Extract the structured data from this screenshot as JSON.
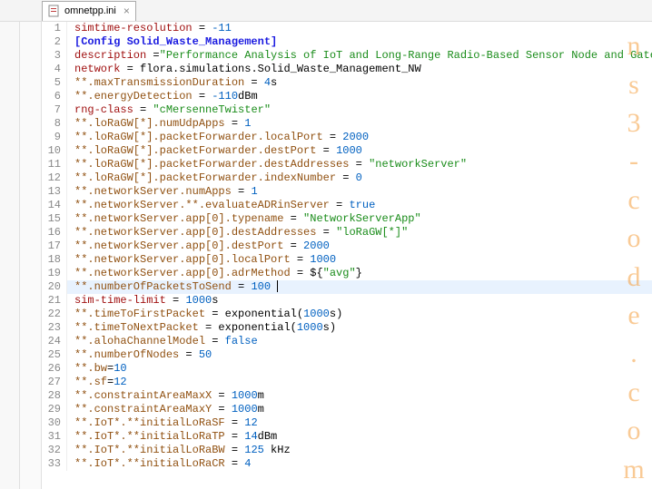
{
  "tab": {
    "title": "omnetpp.ini"
  },
  "watermark": [
    "n",
    "s",
    "3",
    "-",
    "c",
    "o",
    "d",
    "e",
    ".",
    "c",
    "o",
    "m"
  ],
  "lines": [
    {
      "n": 1,
      "ico": "warn",
      "seg": [
        {
          "c": "kw",
          "t": "simtime-resolution"
        },
        {
          "c": "eq",
          "t": " = "
        },
        {
          "c": "num",
          "t": "-11"
        }
      ]
    },
    {
      "n": 2,
      "seg": [
        {
          "c": "sec",
          "t": "[Config Solid_Waste_Management]"
        }
      ]
    },
    {
      "n": 3,
      "seg": [
        {
          "c": "kw",
          "t": "description"
        },
        {
          "c": "eq",
          "t": " ="
        },
        {
          "c": "str",
          "t": "\"Performance Analysis of IoT and Long-Range Radio-Based Sensor Node and Gateway "
        }
      ]
    },
    {
      "n": 4,
      "seg": [
        {
          "c": "kw",
          "t": "network"
        },
        {
          "c": "eq",
          "t": " = flora.simulations.Solid_Waste_Management_NW"
        }
      ]
    },
    {
      "n": 5,
      "seg": [
        {
          "c": "pat",
          "t": "**.maxTransmissionDuration"
        },
        {
          "c": "eq",
          "t": " = "
        },
        {
          "c": "num",
          "t": "4"
        },
        {
          "c": "eq",
          "t": "s"
        }
      ]
    },
    {
      "n": 6,
      "seg": [
        {
          "c": "pat",
          "t": "**.energyDetection"
        },
        {
          "c": "eq",
          "t": " = "
        },
        {
          "c": "num",
          "t": "-110"
        },
        {
          "c": "eq",
          "t": "dBm"
        }
      ]
    },
    {
      "n": 7,
      "seg": [
        {
          "c": "kw",
          "t": "rng-class"
        },
        {
          "c": "eq",
          "t": " = "
        },
        {
          "c": "str",
          "t": "\"cMersenneTwister\""
        }
      ]
    },
    {
      "n": 8,
      "seg": [
        {
          "c": "pat",
          "t": "**.loRaGW[*].numUdpApps"
        },
        {
          "c": "eq",
          "t": " = "
        },
        {
          "c": "num",
          "t": "1"
        }
      ]
    },
    {
      "n": 9,
      "seg": [
        {
          "c": "pat",
          "t": "**.loRaGW[*].packetForwarder.localPort"
        },
        {
          "c": "eq",
          "t": " = "
        },
        {
          "c": "num",
          "t": "2000"
        }
      ]
    },
    {
      "n": 10,
      "seg": [
        {
          "c": "pat",
          "t": "**.loRaGW[*].packetForwarder.destPort"
        },
        {
          "c": "eq",
          "t": " = "
        },
        {
          "c": "num",
          "t": "1000"
        }
      ]
    },
    {
      "n": 11,
      "seg": [
        {
          "c": "pat",
          "t": "**.loRaGW[*].packetForwarder.destAddresses"
        },
        {
          "c": "eq",
          "t": " = "
        },
        {
          "c": "str",
          "t": "\"networkServer\""
        }
      ]
    },
    {
      "n": 12,
      "ico": "info",
      "seg": [
        {
          "c": "pat",
          "t": "**.loRaGW[*].packetForwarder.indexNumber"
        },
        {
          "c": "eq",
          "t": " = "
        },
        {
          "c": "num",
          "t": "0"
        }
      ]
    },
    {
      "n": 13,
      "seg": [
        {
          "c": "pat",
          "t": "**.networkServer.numApps"
        },
        {
          "c": "eq",
          "t": " = "
        },
        {
          "c": "num",
          "t": "1"
        }
      ]
    },
    {
      "n": 14,
      "seg": [
        {
          "c": "pat",
          "t": "**.networkServer.**.evaluateADRinServer"
        },
        {
          "c": "eq",
          "t": " = "
        },
        {
          "c": "num",
          "t": "true"
        }
      ]
    },
    {
      "n": 15,
      "seg": [
        {
          "c": "pat",
          "t": "**.networkServer.app[0].typename"
        },
        {
          "c": "eq",
          "t": " = "
        },
        {
          "c": "str",
          "t": "\"NetworkServerApp\""
        }
      ]
    },
    {
      "n": 16,
      "ico": "info",
      "seg": [
        {
          "c": "pat",
          "t": "**.networkServer.app[0].destAddresses"
        },
        {
          "c": "eq",
          "t": " = "
        },
        {
          "c": "str",
          "t": "\"loRaGW[*]\""
        }
      ]
    },
    {
      "n": 17,
      "seg": [
        {
          "c": "pat",
          "t": "**.networkServer.app[0].destPort"
        },
        {
          "c": "eq",
          "t": " = "
        },
        {
          "c": "num",
          "t": "2000"
        }
      ]
    },
    {
      "n": 18,
      "seg": [
        {
          "c": "pat",
          "t": "**.networkServer.app[0].localPort"
        },
        {
          "c": "eq",
          "t": " = "
        },
        {
          "c": "num",
          "t": "1000"
        }
      ]
    },
    {
      "n": 19,
      "seg": [
        {
          "c": "pat",
          "t": "**.networkServer.app[0].adrMethod"
        },
        {
          "c": "eq",
          "t": " = ${"
        },
        {
          "c": "str",
          "t": "\"avg\""
        },
        {
          "c": "eq",
          "t": "}"
        }
      ]
    },
    {
      "n": 20,
      "hl": true,
      "seg": [
        {
          "c": "pat",
          "t": "**.numberOfPacketsToSend"
        },
        {
          "c": "eq",
          "t": " = "
        },
        {
          "c": "num",
          "t": "100"
        },
        {
          "c": "eq",
          "t": " "
        }
      ],
      "cursor": true
    },
    {
      "n": 21,
      "seg": [
        {
          "c": "kw",
          "t": "sim-time-limit"
        },
        {
          "c": "eq",
          "t": " = "
        },
        {
          "c": "num",
          "t": "1000"
        },
        {
          "c": "eq",
          "t": "s"
        }
      ]
    },
    {
      "n": 22,
      "seg": [
        {
          "c": "pat",
          "t": "**.timeToFirstPacket"
        },
        {
          "c": "eq",
          "t": " = exponential("
        },
        {
          "c": "num",
          "t": "1000"
        },
        {
          "c": "eq",
          "t": "s)"
        }
      ]
    },
    {
      "n": 23,
      "seg": [
        {
          "c": "pat",
          "t": "**.timeToNextPacket"
        },
        {
          "c": "eq",
          "t": " = exponential("
        },
        {
          "c": "num",
          "t": "1000"
        },
        {
          "c": "eq",
          "t": "s)"
        }
      ]
    },
    {
      "n": 24,
      "ico": "info",
      "seg": [
        {
          "c": "pat",
          "t": "**.alohaChannelModel"
        },
        {
          "c": "eq",
          "t": " = "
        },
        {
          "c": "num",
          "t": "false"
        }
      ]
    },
    {
      "n": 25,
      "ico": "info",
      "seg": [
        {
          "c": "pat",
          "t": "**.numberOfNodes"
        },
        {
          "c": "eq",
          "t": " = "
        },
        {
          "c": "num",
          "t": "50"
        }
      ]
    },
    {
      "n": 26,
      "seg": [
        {
          "c": "pat",
          "t": "**.bw"
        },
        {
          "c": "eq",
          "t": "="
        },
        {
          "c": "num",
          "t": "10"
        }
      ]
    },
    {
      "n": 27,
      "seg": [
        {
          "c": "pat",
          "t": "**.sf"
        },
        {
          "c": "eq",
          "t": "="
        },
        {
          "c": "num",
          "t": "12"
        }
      ]
    },
    {
      "n": 28,
      "seg": [
        {
          "c": "pat",
          "t": "**.constraintAreaMaxX"
        },
        {
          "c": "eq",
          "t": " = "
        },
        {
          "c": "num",
          "t": "1000"
        },
        {
          "c": "eq",
          "t": "m"
        }
      ]
    },
    {
      "n": 29,
      "seg": [
        {
          "c": "pat",
          "t": "**.constraintAreaMaxY"
        },
        {
          "c": "eq",
          "t": " = "
        },
        {
          "c": "num",
          "t": "1000"
        },
        {
          "c": "eq",
          "t": "m"
        }
      ]
    },
    {
      "n": 30,
      "ico": "info",
      "seg": [
        {
          "c": "pat",
          "t": "**.IoT*.**initialLoRaSF"
        },
        {
          "c": "eq",
          "t": " = "
        },
        {
          "c": "num",
          "t": "12"
        }
      ]
    },
    {
      "n": 31,
      "ico": "info",
      "seg": [
        {
          "c": "pat",
          "t": "**.IoT*.**initialLoRaTP"
        },
        {
          "c": "eq",
          "t": " = "
        },
        {
          "c": "num",
          "t": "14"
        },
        {
          "c": "eq",
          "t": "dBm"
        }
      ]
    },
    {
      "n": 32,
      "seg": [
        {
          "c": "pat",
          "t": "**.IoT*.**initialLoRaBW"
        },
        {
          "c": "eq",
          "t": " = "
        },
        {
          "c": "num",
          "t": "125"
        },
        {
          "c": "eq",
          "t": " kHz"
        }
      ]
    },
    {
      "n": 33,
      "ico": "info",
      "seg": [
        {
          "c": "pat",
          "t": "**.IoT*.**initialLoRaCR"
        },
        {
          "c": "eq",
          "t": " = "
        },
        {
          "c": "num",
          "t": "4"
        }
      ]
    }
  ]
}
